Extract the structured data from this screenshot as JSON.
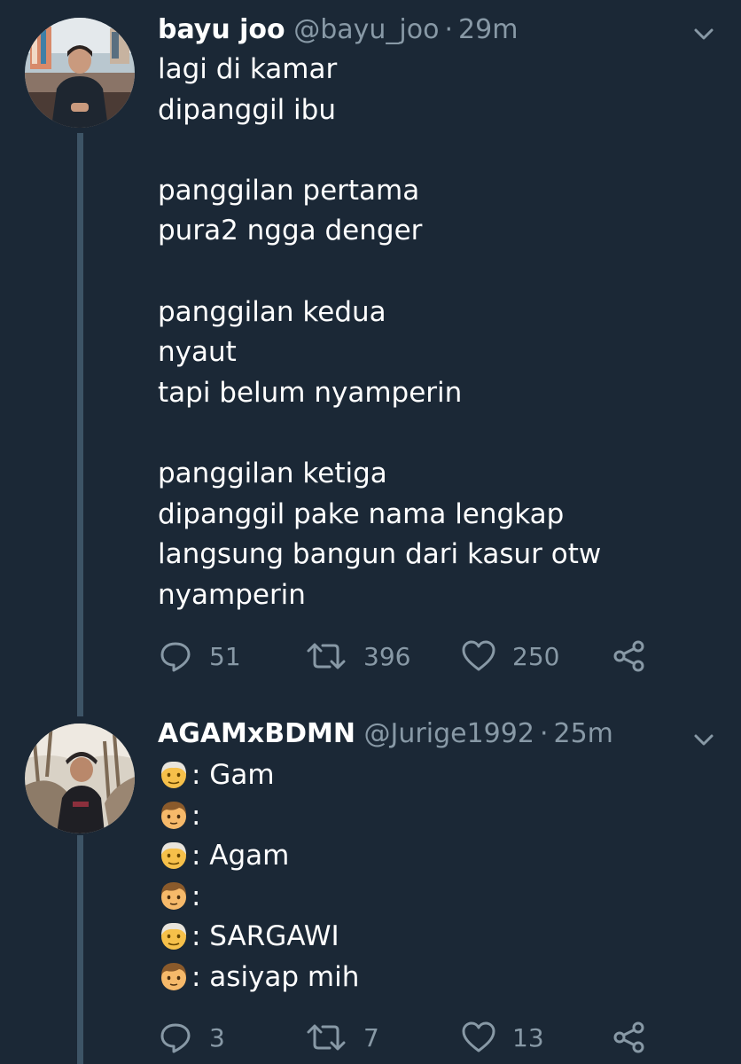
{
  "tweets": [
    {
      "display_name": "bayu joo",
      "handle": "@bayu_joo",
      "separator": "·",
      "time": "29m",
      "lines": [
        {
          "text": "lagi di kamar"
        },
        {
          "text": "dipanggil ibu"
        },
        {
          "text": ""
        },
        {
          "text": "panggilan pertama"
        },
        {
          "text": "pura2 ngga denger"
        },
        {
          "text": ""
        },
        {
          "text": "panggilan kedua"
        },
        {
          "text": "nyaut"
        },
        {
          "text": "tapi belum nyamperin"
        },
        {
          "text": ""
        },
        {
          "text": "panggilan ketiga"
        },
        {
          "text": "dipanggil pake nama lengkap"
        },
        {
          "text": "langsung bangun dari kasur otw"
        },
        {
          "text": "nyamperin"
        }
      ],
      "replies": "51",
      "retweets": "396",
      "likes": "250"
    },
    {
      "display_name": "AGAMxBDMN",
      "handle": "@Jurige1992",
      "separator": "·",
      "time": "25m",
      "lines": [
        {
          "emoji": "older-man-emoji",
          "text": ": Gam"
        },
        {
          "emoji": "boy-emoji",
          "text": ":"
        },
        {
          "emoji": "older-man-emoji",
          "text": ": Agam"
        },
        {
          "emoji": "boy-emoji",
          "text": ":"
        },
        {
          "emoji": "older-man-emoji",
          "text": ": SARGAWI"
        },
        {
          "emoji": "boy-emoji",
          "text": ": asiyap mih"
        }
      ],
      "replies": "3",
      "retweets": "7",
      "likes": "13"
    }
  ],
  "icons": {
    "reply": "reply-icon",
    "retweet": "retweet-icon",
    "like": "heart-icon",
    "share": "share-icon",
    "menu": "chevron-down-icon"
  },
  "colors": {
    "background": "#1b2836",
    "text": "#ffffff",
    "secondary": "#8899a6",
    "thread_line": "#3d5466"
  }
}
